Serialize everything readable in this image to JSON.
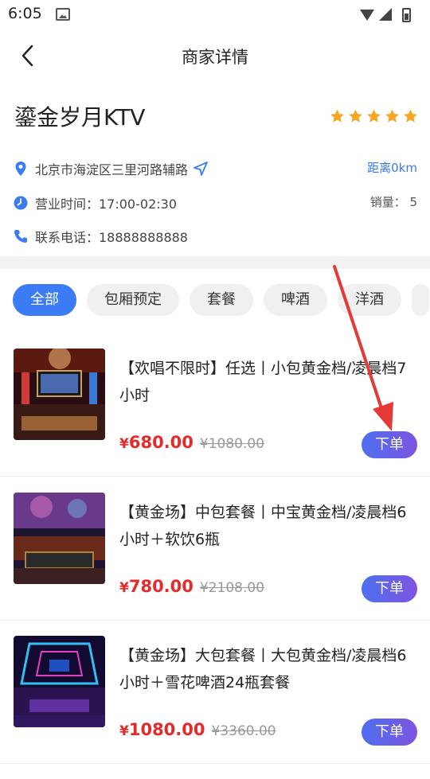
{
  "status": {
    "time": "6:05"
  },
  "nav": {
    "title": "商家详情"
  },
  "shop": {
    "name": "鎏金岁月KTV",
    "rating_stars": 5,
    "address": "北京市海淀区三里河路辅路",
    "distance": "距离0km",
    "hours": "营业时间：17:00-02:30",
    "sales": "销量： 5",
    "phone": "联系电话：18888888888"
  },
  "tabs": [
    "全部",
    "包厢预定",
    "套餐",
    "啤酒",
    "洋酒"
  ],
  "products": [
    {
      "title": "【欢唱不限时】任选丨小包黄金档/凌晨档7小时",
      "price_symbol": "¥",
      "price": "680.00",
      "original": "¥1080.00",
      "button": "下单"
    },
    {
      "title": "【黄金场】中包套餐丨中宝黄金档/凌晨档6小时＋软饮6瓶",
      "price_symbol": "¥",
      "price": "780.00",
      "original": "¥2108.00",
      "button": "下单"
    },
    {
      "title": "【黄金场】大包套餐丨大包黄金档/凌晨档6小时＋雪花啤酒24瓶套餐",
      "price_symbol": "¥",
      "price": "1080.00",
      "original": "¥3360.00",
      "button": "下单"
    }
  ],
  "colors": {
    "accent": "#3b7cf4",
    "price": "#e52a2a",
    "star": "#f5a623",
    "annotation": "#e53935"
  }
}
